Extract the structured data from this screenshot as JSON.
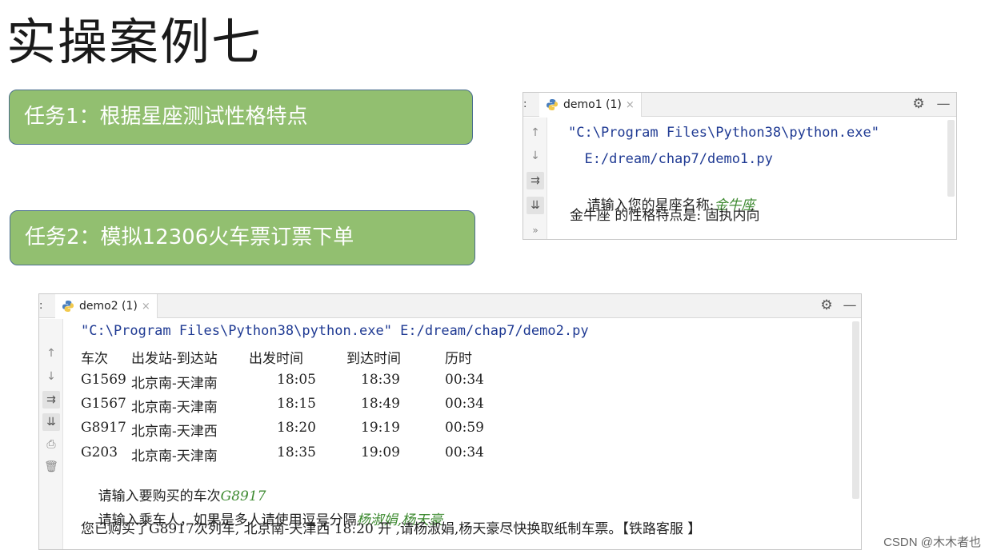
{
  "title": "实操案例七",
  "tasks": [
    {
      "label": "任务1：根据星座测试性格特点"
    },
    {
      "label": "任务2：模拟12306火车票订票下单"
    }
  ],
  "console1": {
    "tab": {
      "label": "demo1 (1)",
      "close": "×"
    },
    "left_cut": ":",
    "lines": [
      "\"C:\\Program Files\\Python38\\python.exe\"",
      "  E:/dream/chap7/demo1.py",
      "请输入您的星座名称:",
      "金牛座 的性格特点是: 固执内向"
    ],
    "user_input": "金牛座"
  },
  "console2": {
    "tab": {
      "label": "demo2 (1)",
      "close": "×"
    },
    "left_cut": ":",
    "command": "\"C:\\Program Files\\Python38\\python.exe\" E:/dream/chap7/demo2.py",
    "table": {
      "headers": [
        "车次",
        "出发站-到达站",
        "出发时间",
        "到达时间",
        "历时"
      ],
      "rows": [
        [
          "G1569",
          "北京南-天津南",
          "18:05",
          "18:39",
          "00:34"
        ],
        [
          "G1567",
          "北京南-天津南",
          "18:15",
          "18:49",
          "00:34"
        ],
        [
          "G8917",
          "北京南-天津西",
          "18:20",
          "19:19",
          "00:59"
        ],
        [
          "G203",
          "北京南-天津南",
          "18:35",
          "19:09",
          "00:34"
        ]
      ]
    },
    "prompt_train": "请输入要购买的车次",
    "input_train": "G8917",
    "prompt_passenger": "请输入乘车人，如果是多人请使用逗号分隔",
    "input_passenger": "杨淑娟,杨天豪",
    "result": "您已购买了G8917次列车, 北京南-天津西 18:20 开 ,请杨淑娟,杨天豪尽快换取纸制车票。【铁路客服 】"
  },
  "watermark": "CSDN @木木者也",
  "icons": {
    "up": "arrow-up-icon",
    "down": "arrow-down-icon",
    "wrap": "soft-wrap-icon",
    "scroll_end": "scroll-to-end-icon",
    "print": "print-icon",
    "trash": "trash-icon",
    "more": "more-icon",
    "gear": "gear-icon",
    "minimize": "minimize-icon"
  },
  "colors": {
    "task_fill": "#92bf70",
    "task_border": "#4a6e8e",
    "path_text": "#1f3a93",
    "user_input": "#3d8a30"
  }
}
